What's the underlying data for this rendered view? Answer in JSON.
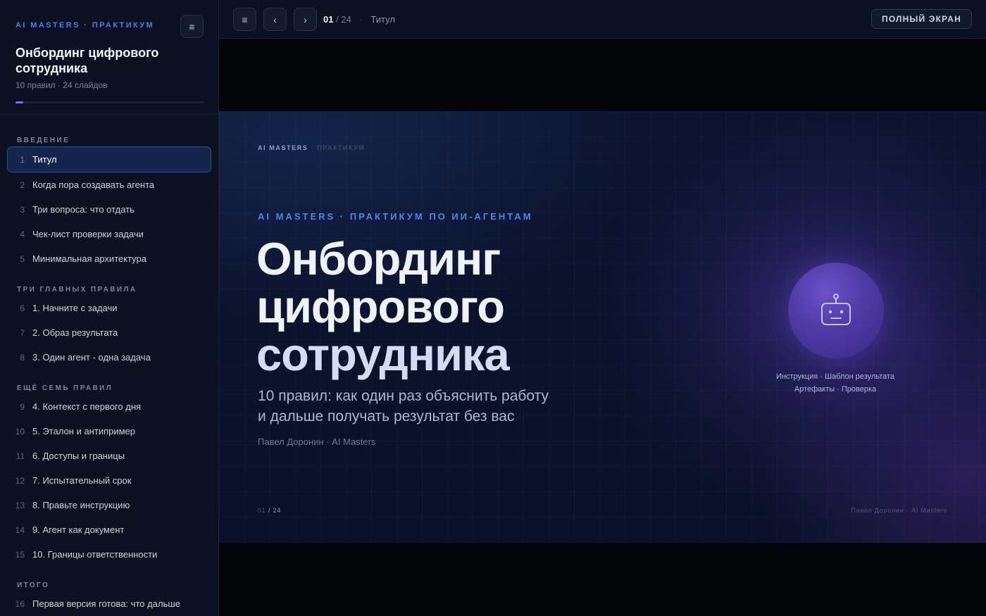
{
  "sidebar": {
    "brand": "AI MASTERS · ПРАКТИКУМ",
    "title": "Онбординг цифрового сотрудника",
    "subtitle": "10 правил · 24 слайдов",
    "progress_fraction": 0.04,
    "sections": [
      {
        "title": "ВВЕДЕНИЕ",
        "items": [
          {
            "num": "1",
            "label": "Титул",
            "active": true
          },
          {
            "num": "2",
            "label": "Когда пора создавать агента"
          },
          {
            "num": "3",
            "label": "Три вопроса: что отдать"
          },
          {
            "num": "4",
            "label": "Чек-лист проверки задачи"
          },
          {
            "num": "5",
            "label": "Минимальная архитектура"
          }
        ]
      },
      {
        "title": "ТРИ ГЛАВНЫХ ПРАВИЛА",
        "items": [
          {
            "num": "6",
            "label": "1. Начните с задачи"
          },
          {
            "num": "7",
            "label": "2. Образ результата"
          },
          {
            "num": "8",
            "label": "3. Один агент - одна задача"
          }
        ]
      },
      {
        "title": "ЕЩЁ СЕМЬ ПРАВИЛ",
        "items": [
          {
            "num": "9",
            "label": "4. Контекст с первого дня"
          },
          {
            "num": "10",
            "label": "5. Эталон и антипример"
          },
          {
            "num": "11",
            "label": "6. Доступы и границы"
          },
          {
            "num": "12",
            "label": "7. Испытательный срок"
          },
          {
            "num": "13",
            "label": "8. Правьте инструкцию"
          },
          {
            "num": "14",
            "label": "9. Агент как документ"
          },
          {
            "num": "15",
            "label": "10. Границы ответственности"
          }
        ]
      },
      {
        "title": "ИТОГО",
        "items": [
          {
            "num": "16",
            "label": "Первая версия готова: что дальше"
          }
        ]
      }
    ]
  },
  "topbar": {
    "menu_icon": "≡",
    "prev_icon": "‹",
    "next_icon": "›",
    "current": "01",
    "separator": "/",
    "total": "24",
    "dot": "·",
    "slide_title": "Титул",
    "fullscreen_label": "ПОЛНЫЙ ЭКРАН"
  },
  "slide": {
    "brand_small": "AI MASTERS",
    "brand_small_muted": "· ПРАКТИКУМ",
    "kicker": "AI MASTERS · ПРАКТИКУМ ПО ИИ-АГЕНТАМ",
    "title_lines": [
      "Онбординг",
      "цифрового",
      "сотрудника"
    ],
    "subtitle_lines": [
      "10 правил: как один раз объяснить работу",
      "и дальше получать результат без вас"
    ],
    "author": "Павел Доронин · AI Masters",
    "page_current": "01",
    "page_total": "/ 24",
    "footer_right": "Павел Доронин · AI Masters",
    "orb_icon": "robot-icon",
    "orb_caption_lines": [
      "Инструкция · Шаблон результата",
      "Артефакты · Проверка"
    ]
  },
  "colors": {
    "accent": "#4b86f0",
    "active_item_bg": "#15264a",
    "orb": "#5a44b8"
  }
}
